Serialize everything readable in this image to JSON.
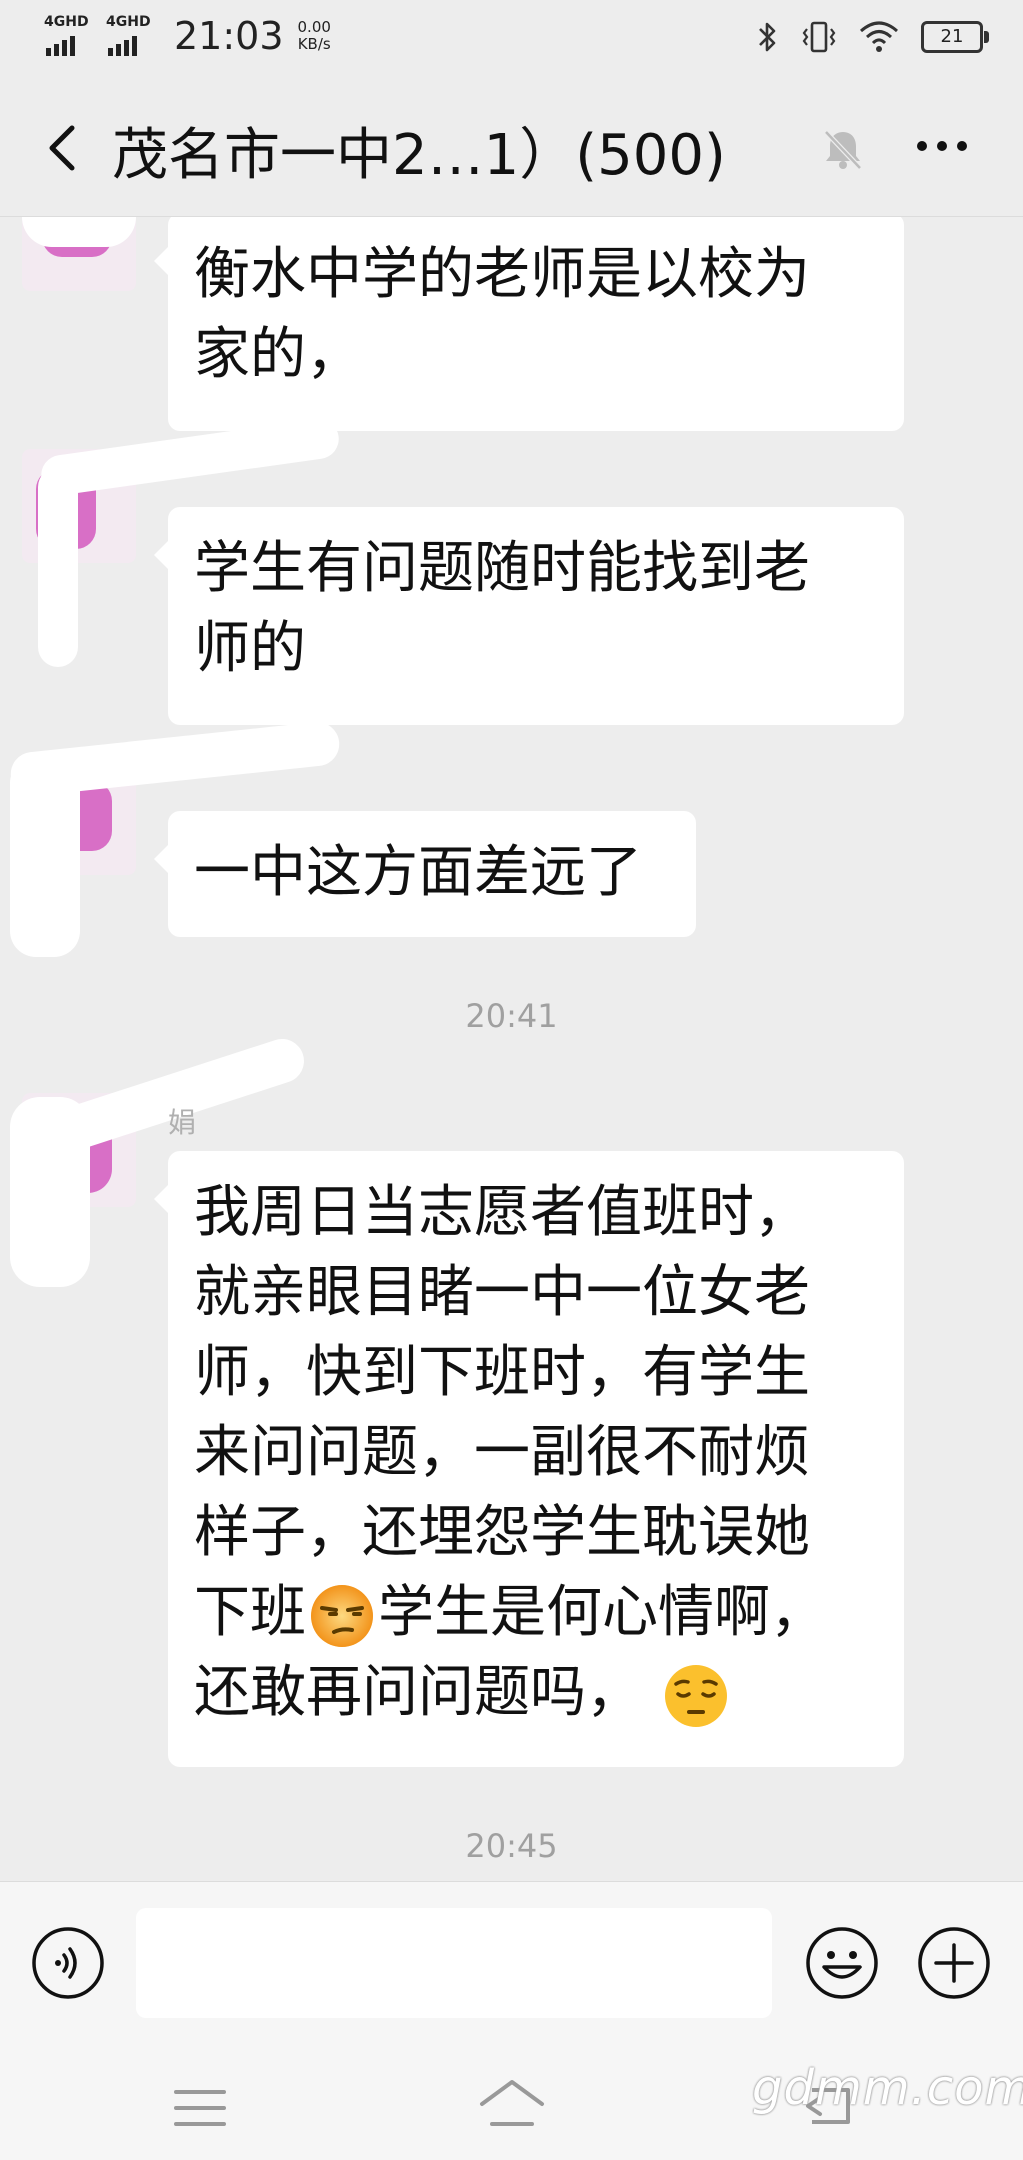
{
  "status_bar": {
    "signal1_label": "4GHD",
    "signal2_label": "4GHD",
    "time": "21:03",
    "speed_value": "0.00",
    "speed_unit": "KB/s",
    "battery": "21"
  },
  "header": {
    "title": "茂名市一中2…1）(500)"
  },
  "messages": [
    {
      "nick": "",
      "lines": [
        "衡水中学的老师是以校为",
        "家的，"
      ]
    },
    {
      "nick": "",
      "lines": [
        "学生有问题随时能找到老",
        "师的"
      ]
    },
    {
      "nick": "",
      "lines": [
        "一中这方面差远了"
      ]
    },
    {
      "nick": "娟",
      "lines": [
        "我周日当志愿者值班时，",
        "就亲眼目睹一中一位女老",
        "师，快到下班时，有学生",
        "来问问题，一副很不耐烦",
        "样子，还埋怨学生耽误她"
      ],
      "line6_a": "下班",
      "line6_b": "学生是何心情啊，",
      "line7": "还敢再问问题吗，",
      "emojis": [
        "unamused-face-emoji",
        "pensive-face-emoji"
      ]
    }
  ],
  "timestamps": [
    "20:41",
    "20:45"
  ],
  "input_bar": {
    "icons": [
      "voice-icon",
      "emoji-icon",
      "plus-icon"
    ]
  },
  "nav_bar": {
    "icons": [
      "menu-icon",
      "home-icon",
      "back-icon"
    ]
  },
  "watermark": "gdmm.com"
}
